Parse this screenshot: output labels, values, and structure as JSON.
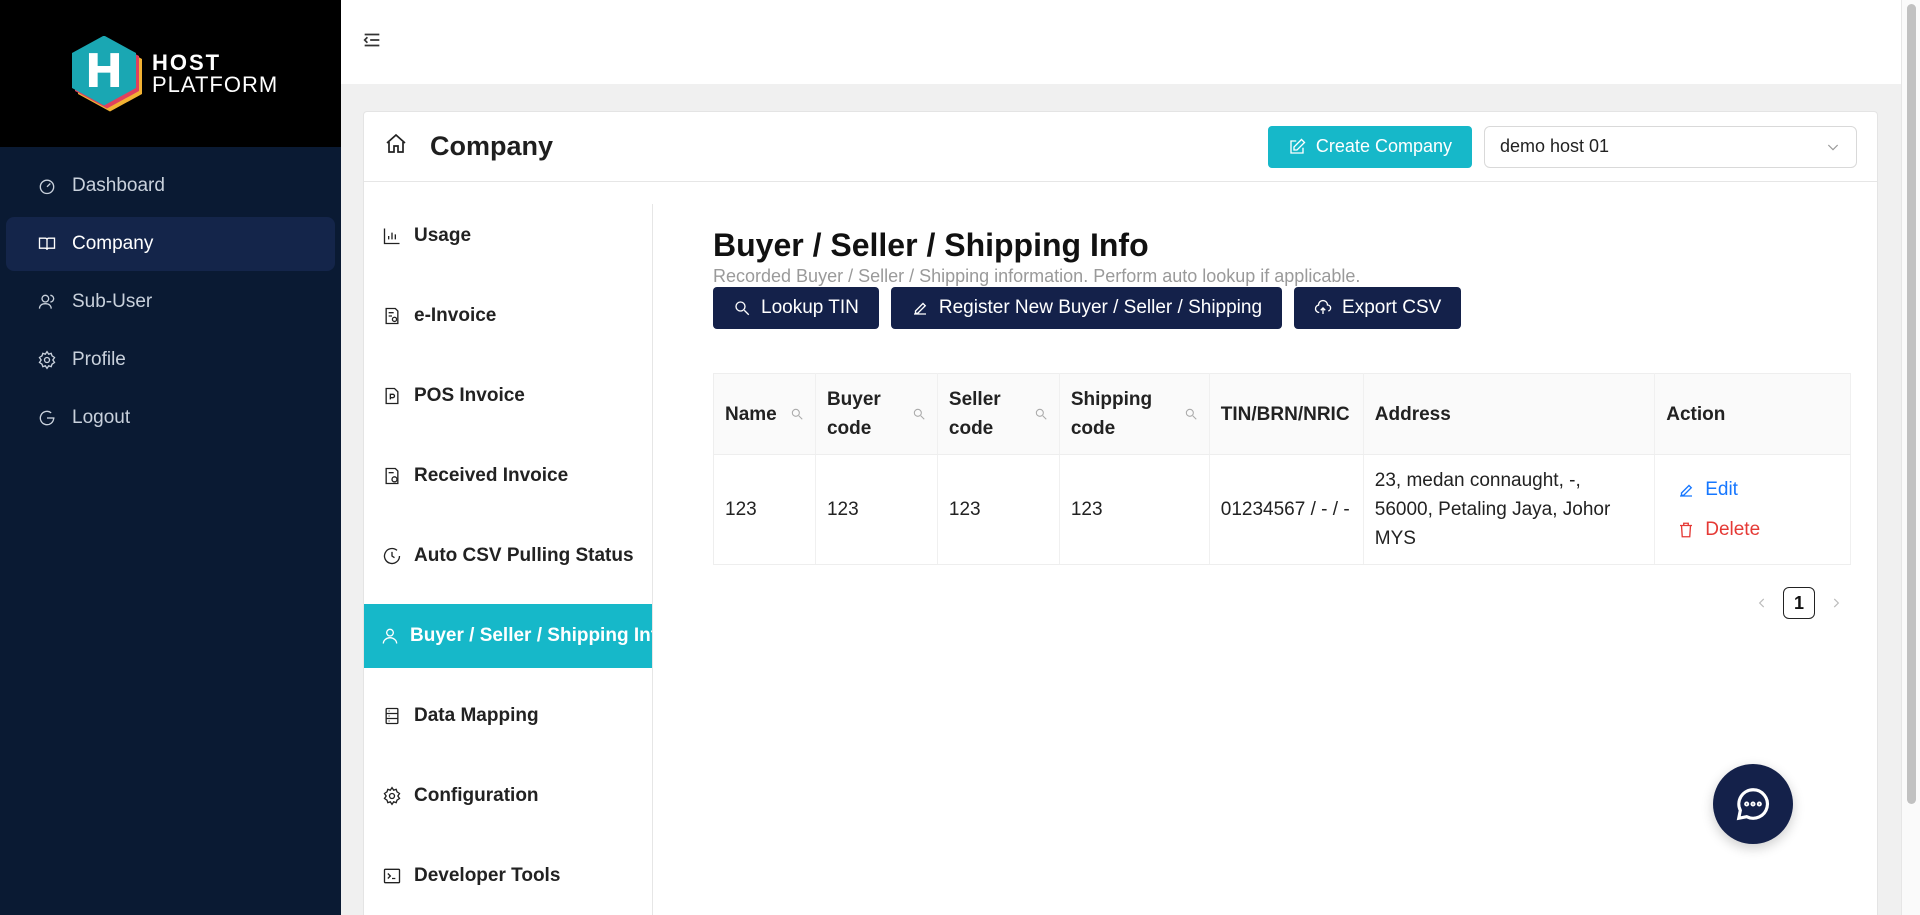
{
  "brand": {
    "line1": "HOST",
    "line2": "PLATFORM",
    "mark": "H"
  },
  "sidebar": {
    "items": [
      {
        "label": "Dashboard",
        "icon": "dashboard-icon"
      },
      {
        "label": "Company",
        "icon": "book-icon",
        "active": true
      },
      {
        "label": "Sub-User",
        "icon": "users-icon"
      },
      {
        "label": "Profile",
        "icon": "gear-icon"
      },
      {
        "label": "Logout",
        "icon": "logout-icon"
      }
    ]
  },
  "header": {
    "title": "Company",
    "create_label": "Create Company",
    "company_select": "demo host 01"
  },
  "subnav": {
    "items": [
      {
        "label": "Usage"
      },
      {
        "label": "e-Invoice"
      },
      {
        "label": "POS Invoice"
      },
      {
        "label": "Received Invoice"
      },
      {
        "label": "Auto CSV Pulling Status"
      },
      {
        "label": "Buyer / Seller / Shipping Info",
        "active": true
      },
      {
        "label": "Data Mapping"
      },
      {
        "label": "Configuration"
      },
      {
        "label": "Developer Tools"
      }
    ]
  },
  "main": {
    "title": "Buyer / Seller / Shipping Info",
    "description": "Recorded Buyer / Seller / Shipping information. Perform auto lookup if applicable.",
    "actions": {
      "lookup": "Lookup TIN",
      "register": "Register New Buyer / Seller / Shipping",
      "export": "Export CSV"
    },
    "table": {
      "columns": [
        "Name",
        "Buyer code",
        "Seller code",
        "Shipping code",
        "TIN/BRN/NRIC",
        "Address",
        "Action"
      ],
      "rows": [
        {
          "name": "123",
          "buyer_code": "123",
          "seller_code": "123",
          "shipping_code": "123",
          "tin": "01234567 / - / -",
          "address": "23, medan connaught, -, 56000, Petaling Jaya, Johor MYS",
          "edit": "Edit",
          "delete": "Delete"
        }
      ]
    },
    "pagination": {
      "current": "1"
    }
  },
  "colors": {
    "accent": "#16b8c9",
    "dark": "#14214a",
    "sidebar": "#0a1a33"
  }
}
